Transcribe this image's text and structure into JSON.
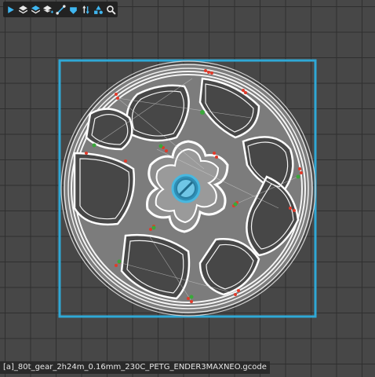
{
  "toolbar": {
    "tools": [
      {
        "name": "play-icon"
      },
      {
        "name": "layers-icon"
      },
      {
        "name": "layers-add-icon"
      },
      {
        "name": "layers-add-plus-icon"
      },
      {
        "name": "travel-path-icon"
      },
      {
        "name": "fill-bucket-icon"
      },
      {
        "name": "retract-arrows-icon"
      },
      {
        "name": "shapes-icon"
      },
      {
        "name": "zoom-search-icon"
      }
    ]
  },
  "status": {
    "filename": "[a]_80t_gear_2h24m_0.16mm_230C_PETG_ENDER3MAXNEO.gcode"
  },
  "colors": {
    "grid_bg": "#474747",
    "bounding_box": "#2fa8d6",
    "perimeter": "#f2f2f2",
    "infill": "#9a9a9a",
    "hub_accent": "#49b8df",
    "retraction": "#e23a2a",
    "seam": "#3aa83a"
  }
}
